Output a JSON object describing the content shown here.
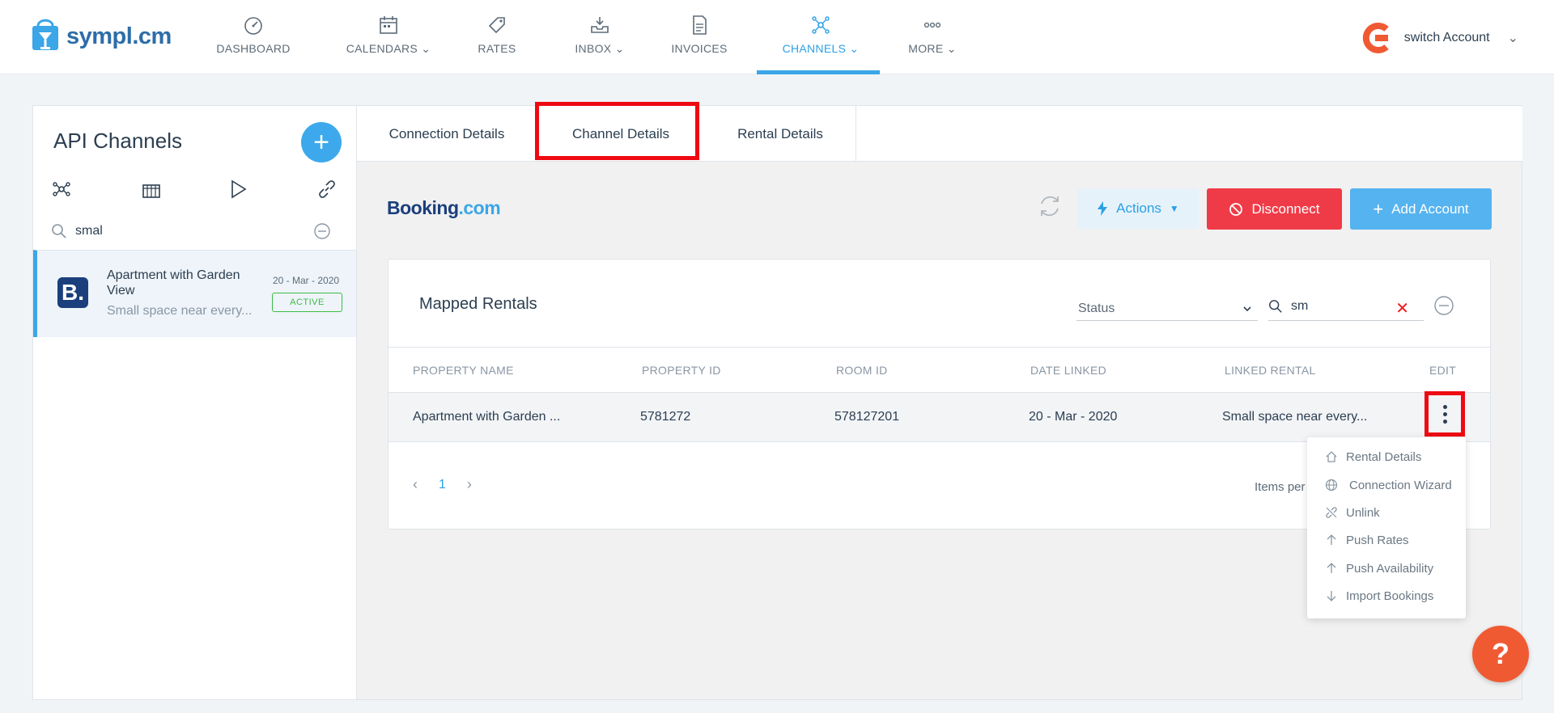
{
  "brand": {
    "name": "sympl.cm"
  },
  "nav": [
    {
      "label": "DASHBOARD",
      "icon": "gauge-icon"
    },
    {
      "label": "CALENDARS",
      "icon": "calendar-icon"
    },
    {
      "label": "RATES",
      "icon": "tag-icon"
    },
    {
      "label": "INBOX",
      "icon": "inbox-icon"
    },
    {
      "label": "INVOICES",
      "icon": "invoice-icon"
    },
    {
      "label": "CHANNELS",
      "icon": "network-icon",
      "active": true
    },
    {
      "label": "MORE",
      "icon": "dots-icon"
    }
  ],
  "account": {
    "label": "switch Account"
  },
  "sidebar": {
    "title": "API Channels",
    "search_value": "smal",
    "item": {
      "name": "Apartment with Garden View",
      "subtitle": "Small space near every...",
      "date": "20 - Mar - 2020",
      "badge": "ACTIVE"
    }
  },
  "tabs": [
    {
      "label": "Connection Details"
    },
    {
      "label": "Channel Details",
      "active": true
    },
    {
      "label": "Rental Details"
    }
  ],
  "channel": {
    "logo_main": "Booking",
    "logo_suffix": ".com",
    "actions_label": "Actions",
    "disconnect_label": "Disconnect",
    "add_account_label": "Add Account"
  },
  "mapped": {
    "title": "Mapped Rentals",
    "status_placeholder": "Status",
    "search_value": "sm",
    "columns": [
      "PROPERTY NAME",
      "PROPERTY ID",
      "ROOM ID",
      "DATE LINKED",
      "LINKED RENTAL",
      "EDIT"
    ],
    "row": {
      "property_name": "Apartment with Garden ...",
      "property_id": "5781272",
      "room_id": "578127201",
      "date_linked": "20 - Mar - 2020",
      "linked_rental": "Small space near every..."
    },
    "page": "1",
    "items_per": "Items per"
  },
  "row_menu": [
    {
      "label": "Rental Details",
      "icon": "home-icon"
    },
    {
      "label": "Connection Wizard",
      "icon": "globe-icon"
    },
    {
      "label": "Unlink",
      "icon": "unlink-icon"
    },
    {
      "label": "Push Rates",
      "icon": "arrow-up-icon"
    },
    {
      "label": "Push Availability",
      "icon": "arrow-up-icon"
    },
    {
      "label": "Import Bookings",
      "icon": "arrow-down-icon"
    }
  ],
  "help": {
    "label": "?"
  },
  "colors": {
    "accent": "#3ba6e8",
    "danger": "#ef3b47",
    "highlight": "#ee0a12",
    "help": "#f05a32",
    "active_badge": "#3dbb45"
  }
}
